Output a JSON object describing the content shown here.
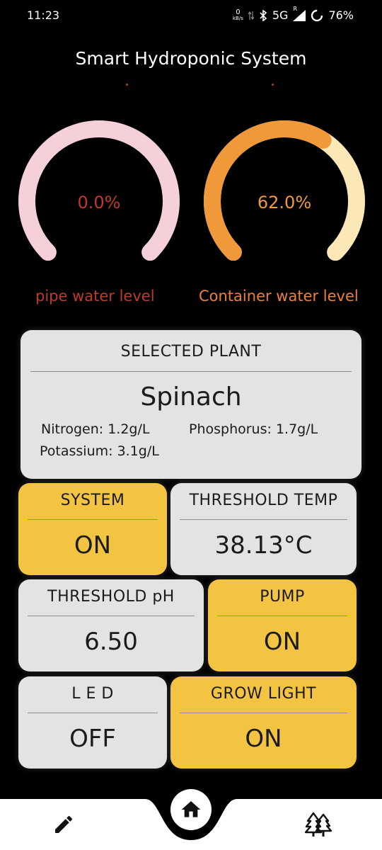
{
  "status_bar": {
    "time": "11:23",
    "net_speed_value": "0",
    "net_speed_unit": "kB/s",
    "network": "5G",
    "roaming": "R",
    "battery": "76%"
  },
  "app": {
    "title": "Smart Hydroponic System"
  },
  "gauges": [
    {
      "value": 0.0,
      "display": "0.0%",
      "label": "pipe water level",
      "track_color": "#f6d0d8",
      "fill_color": "#f39aa8",
      "text_color": "#c0392b",
      "label_color": "#c0392b"
    },
    {
      "value": 62.0,
      "display": "62.0%",
      "label": "Container water level",
      "track_color": "#fbe8b6",
      "fill_color": "#f0993a",
      "text_color": "#f0993a",
      "label_color": "#ee7f3a"
    }
  ],
  "plant_card": {
    "header": "SELECTED PLANT",
    "plant": "Spinach",
    "nitrogen": "Nitrogen: 1.2g/L",
    "phosphorus": "Phosphorus: 1.7g/L",
    "potassium": "Potassium: 3.1g/L"
  },
  "tiles": {
    "system": {
      "header": "SYSTEM",
      "value": "ON"
    },
    "threshold_temp": {
      "header": "THRESHOLD TEMP",
      "value": "38.13°C"
    },
    "threshold_ph": {
      "header": "THRESHOLD pH",
      "value": "6.50"
    },
    "pump": {
      "header": "PUMP",
      "value": "ON"
    },
    "led": {
      "header": "L E D",
      "value": "OFF"
    },
    "grow_light": {
      "header": "GROW LIGHT",
      "value": "ON"
    }
  },
  "colors": {
    "tile_on": "#f3c342",
    "tile_off": "#e3e3e3"
  },
  "nav": {
    "left_icon": "pencil-icon",
    "center_icon": "home-icon",
    "right_icon": "trees-icon"
  }
}
